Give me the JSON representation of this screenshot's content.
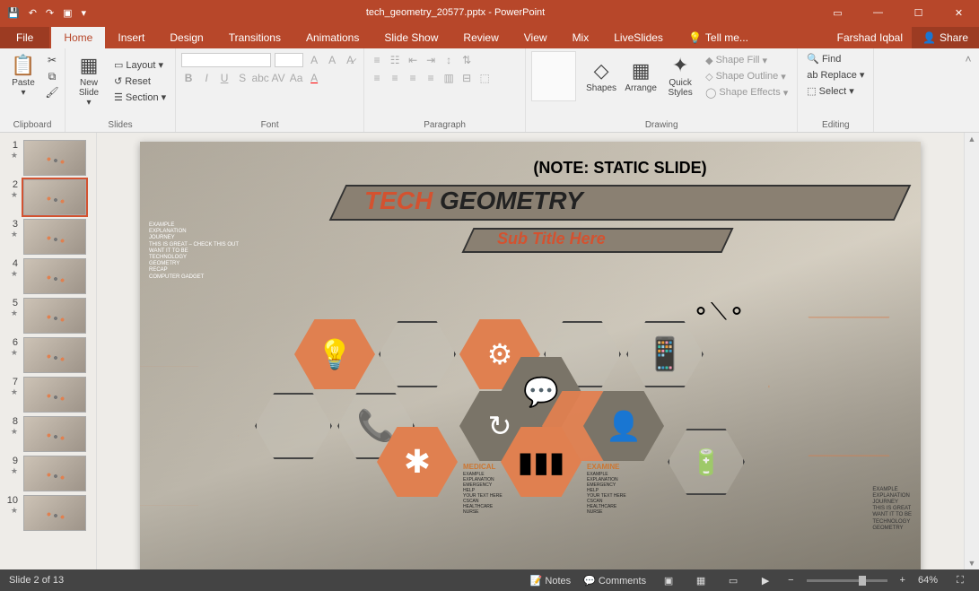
{
  "app": {
    "title": "tech_geometry_20577.pptx - PowerPoint",
    "user": "Farshad Iqbal",
    "share": "Share"
  },
  "tabs": {
    "file": "File",
    "home": "Home",
    "insert": "Insert",
    "design": "Design",
    "transitions": "Transitions",
    "animations": "Animations",
    "slideshow": "Slide Show",
    "review": "Review",
    "view": "View",
    "mix": "Mix",
    "liveslides": "LiveSlides",
    "tellme": "Tell me..."
  },
  "ribbon": {
    "clipboard": {
      "paste": "Paste",
      "label": "Clipboard"
    },
    "slides": {
      "new": "New\nSlide",
      "layout": "Layout",
      "reset": "Reset",
      "section": "Section",
      "label": "Slides"
    },
    "font": {
      "label": "Font"
    },
    "paragraph": {
      "label": "Paragraph"
    },
    "drawing": {
      "shapes": "Shapes",
      "arrange": "Arrange",
      "quick": "Quick\nStyles",
      "fill": "Shape Fill",
      "outline": "Shape Outline",
      "effects": "Shape Effects",
      "label": "Drawing"
    },
    "editing": {
      "find": "Find",
      "replace": "Replace",
      "select": "Select",
      "label": "Editing"
    }
  },
  "slide": {
    "note": "(NOTE: STATIC SLIDE)",
    "title1": "TECH ",
    "title2": "GEOMETRY",
    "subtitle": "Sub Title Here",
    "left_text": "EXAMPLE\nEXPLANATION\nJOURNEY\nTHIS IS GREAT – CHECK THIS OUT\nWANT IT TO BE\nTECHNOLOGY\nGEOMETRY\nRECAP\nCOMPUTER GADGET",
    "right_text": "EXAMPLE\nEXPLANATION\nJOURNEY\nTHIS IS GREAT\nWANT IT TO BE\nTECHNOLOGY\nGEOMETRY",
    "medical": {
      "label": "MEDICAL",
      "text": "EXAMPLE\nEXPLANATION\nEMERGENCY\nHELP\nYOUR TEXT HERE\nCSCAN\nHEALTHCARE\nNURSE"
    },
    "examine": {
      "label": "EXAMINE",
      "text": "EXAMPLE\nEXPLANATION\nEMERGENCY\nHELP\nYOUR TEXT HERE\nCSCAN\nHEALTHCARE\nNURSE"
    }
  },
  "status": {
    "slide_info": "Slide 2 of 13",
    "notes": "Notes",
    "comments": "Comments",
    "zoom": "64%"
  },
  "thumbs": {
    "count": 10,
    "active": 2
  }
}
